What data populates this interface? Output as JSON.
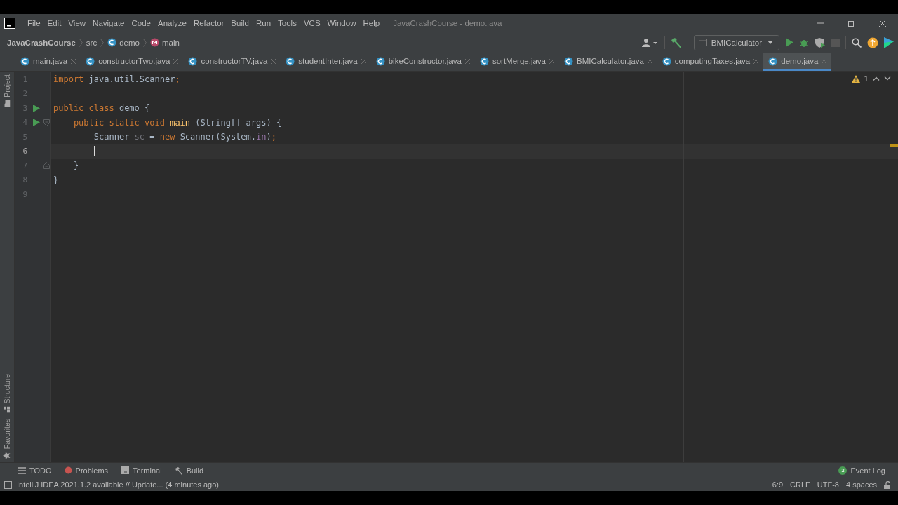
{
  "window": {
    "title": "JavaCrashCourse - demo.java"
  },
  "menu": [
    "File",
    "Edit",
    "View",
    "Navigate",
    "Code",
    "Analyze",
    "Refactor",
    "Build",
    "Run",
    "Tools",
    "VCS",
    "Window",
    "Help"
  ],
  "breadcrumbs": [
    {
      "kind": "project",
      "label": "JavaCrashCourse"
    },
    {
      "kind": "folder",
      "label": "src"
    },
    {
      "kind": "class",
      "label": "demo"
    },
    {
      "kind": "method",
      "label": "main"
    }
  ],
  "run_config": {
    "label": "BMICalculator"
  },
  "tabs": [
    {
      "label": "main.java",
      "selected": false
    },
    {
      "label": "constructorTwo.java",
      "selected": false
    },
    {
      "label": "constructorTV.java",
      "selected": false
    },
    {
      "label": "studentInter.java",
      "selected": false
    },
    {
      "label": "bikeConstructor.java",
      "selected": false
    },
    {
      "label": "sortMerge.java",
      "selected": false
    },
    {
      "label": "BMICalculator.java",
      "selected": false
    },
    {
      "label": "computingTaxes.java",
      "selected": false
    },
    {
      "label": "demo.java",
      "selected": true
    }
  ],
  "left_tools": [
    "Project",
    "Structure",
    "Favorites"
  ],
  "warnings": {
    "count": "1"
  },
  "lines": [
    {
      "number": "1",
      "kind": "plain",
      "run": false,
      "current": false,
      "tokens": [
        {
          "kind": "keyword",
          "text": "import "
        },
        {
          "kind": "plain",
          "text": "java.util.Scanner"
        },
        {
          "kind": "keyword",
          "text": ";"
        }
      ]
    },
    {
      "number": "2",
      "kind": "plain",
      "run": false,
      "current": false
    },
    {
      "number": "3",
      "kind": "plain",
      "run": true,
      "current": false,
      "tokens": [
        {
          "kind": "keyword",
          "text": "public class "
        },
        {
          "kind": "plain",
          "text": "demo {"
        }
      ]
    },
    {
      "number": "4",
      "kind": "opener",
      "run": true,
      "current": false,
      "tokens": [
        {
          "kind": "keyword",
          "text": "    public static void "
        },
        {
          "kind": "method",
          "text": "main "
        },
        {
          "kind": "plain",
          "text": "(String[] args) {"
        }
      ]
    },
    {
      "number": "5",
      "kind": "plain",
      "run": false,
      "current": false,
      "tokens": [
        {
          "kind": "plain",
          "text": "        Scanner "
        },
        {
          "kind": "unused",
          "text": "sc "
        },
        {
          "kind": "plain",
          "text": "= "
        },
        {
          "kind": "keyword",
          "text": "new "
        },
        {
          "kind": "plain",
          "text": "Scanner(System."
        },
        {
          "kind": "field",
          "text": "in"
        },
        {
          "kind": "plain",
          "text": ")"
        },
        {
          "kind": "keyword",
          "text": ";"
        }
      ]
    },
    {
      "number": "6",
      "kind": "plain",
      "run": false,
      "current": true
    },
    {
      "number": "7",
      "kind": "closer",
      "run": false,
      "current": false,
      "tokens": [
        {
          "kind": "plain",
          "text": "    }"
        }
      ]
    },
    {
      "number": "8",
      "kind": "plain",
      "run": false,
      "current": false,
      "tokens": [
        {
          "kind": "plain",
          "text": "}"
        }
      ]
    },
    {
      "number": "9",
      "kind": "plain",
      "run": false,
      "current": false
    }
  ],
  "tool_windows": [
    {
      "kind": "todo",
      "label": "TODO"
    },
    {
      "kind": "problems",
      "label": "Problems"
    },
    {
      "kind": "terminal",
      "label": "Terminal"
    },
    {
      "kind": "build",
      "label": "Build"
    }
  ],
  "event_log": {
    "label": "Event Log",
    "count": "3"
  },
  "status_bar": {
    "message": "IntelliJ IDEA 2021.1.2 available // Update... (4 minutes ago)",
    "items": [
      "6:9",
      "CRLF",
      "UTF-8",
      "4 spaces"
    ]
  }
}
